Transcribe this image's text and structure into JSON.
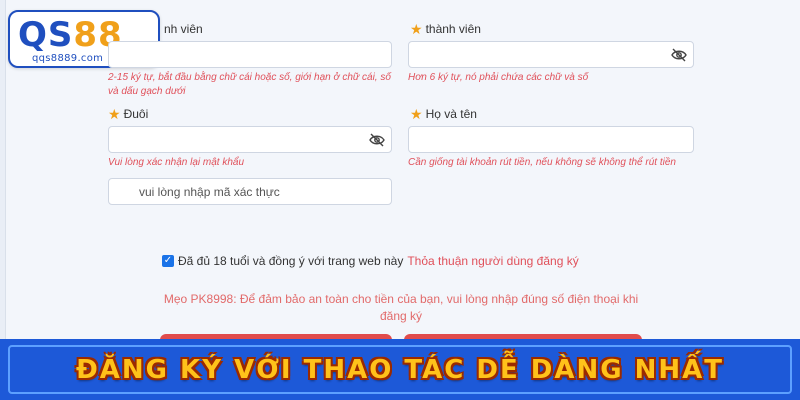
{
  "logo": {
    "main_left": "QS",
    "main_right": "88",
    "sub": "qqs8889.com"
  },
  "fields": {
    "username": {
      "label": "nh viên",
      "hint_line1": "2-15 ký tự, bắt đầu bằng chữ cái hoặc số, giới hạn ở chữ cái, số",
      "hint_line2": "và dấu gạch dưới"
    },
    "password": {
      "label": "thành viên",
      "hint": "Hơn 6 ký tự, nó phải chứa các chữ và số"
    },
    "confirm": {
      "label": "Đuôi",
      "hint": "Vui lòng xác nhận lại mật khẩu"
    },
    "fullname": {
      "label": "Họ và tên",
      "hint": "Cần giống tài khoản rút tiền, nếu không sẽ không thể rút tiền"
    },
    "captcha": {
      "placeholder": "vui lòng nhập mã xác thực"
    }
  },
  "agree": {
    "text": "Đã đủ 18 tuổi và đồng ý với trang web này",
    "link": "Thỏa thuận người dùng đăng ký",
    "checked": true
  },
  "tip": {
    "line1": "Mẹo PK8998: Để đảm bảo an toàn cho tiền của bạn, vui lòng nhập đúng số điện thoại khi",
    "line2": "đăng ký"
  },
  "banner": {
    "text": "ĐĂNG KÝ VỚI THAO TÁC DỄ DÀNG NHẤT"
  },
  "colors": {
    "accent": "#1d59d8",
    "star": "#f0a01a",
    "error": "#e0505a",
    "banner_text": "#ffc21a"
  }
}
